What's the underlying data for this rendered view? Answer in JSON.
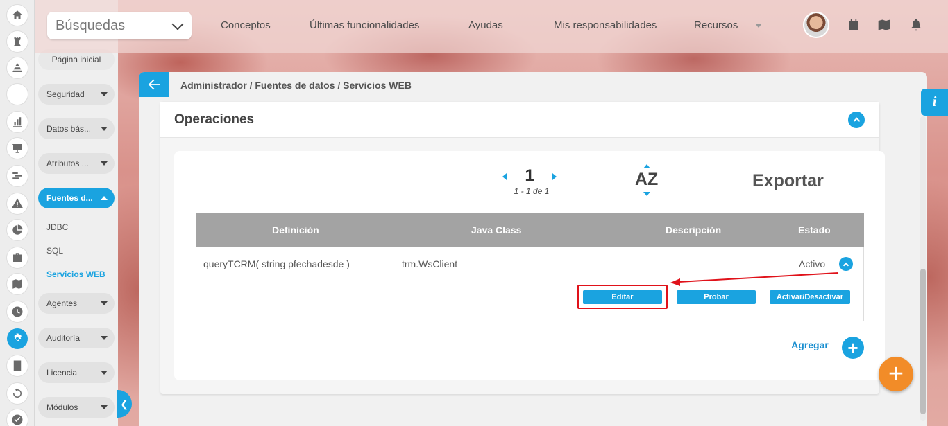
{
  "topbar": {
    "search_label": "Búsquedas",
    "nav": [
      "Conceptos",
      "Últimas funcionalidades",
      "Ayudas",
      "Mis responsabilidades",
      "Recursos"
    ]
  },
  "rail_icons": [
    "home-icon",
    "chess-rook-icon",
    "pyramid-icon",
    "circle-icon",
    "bar-chart-icon",
    "presentation-icon",
    "gantt-icon",
    "warning-icon",
    "pie-chart-icon",
    "briefcase-icon",
    "book-icon",
    "clock-icon",
    "gear-icon",
    "document-icon",
    "refresh-icon",
    "check-icon"
  ],
  "sidebar": {
    "home": "Página inicial",
    "items": [
      "Seguridad",
      "Datos bás...",
      "Atributos ...",
      "Fuentes d...",
      "Agentes",
      "Auditoría",
      "Licencia",
      "Módulos"
    ],
    "sub_items": [
      "JDBC",
      "SQL",
      "Servicios WEB"
    ]
  },
  "breadcrumb": "Administrador / Fuentes de datos / Servicios WEB",
  "card": {
    "title": "Operaciones"
  },
  "pager": {
    "page": "1",
    "range_prefix": "1 - 1",
    "range_de": "de",
    "range_total": "1"
  },
  "sort_label": "AZ",
  "export_label": "Exportar",
  "table": {
    "headers": [
      "Definición",
      "Java Class",
      "Descripción",
      "Estado"
    ],
    "rows": [
      {
        "definicion": "queryTCRM( string pfechadesde )",
        "java_class": "trm.WsClient",
        "descripcion": "",
        "estado": "Activo"
      }
    ]
  },
  "actions": [
    "Editar",
    "Probar",
    "Activar/Desactivar"
  ],
  "add_label": "Agregar",
  "info_label": "i",
  "colors": {
    "accent": "#1aa3e0",
    "fab": "#f28c28",
    "highlight": "#e0121a"
  }
}
